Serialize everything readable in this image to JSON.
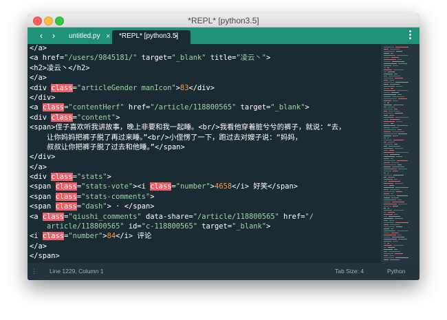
{
  "window": {
    "title": "*REPL* [python3.5]"
  },
  "nav": {
    "back_icon": "‹",
    "forward_icon": "›"
  },
  "tabs": [
    {
      "label": "untitled.py",
      "close": "×"
    },
    {
      "label": "*REPL* [python3.5]",
      "close": "×"
    }
  ],
  "colors": {
    "accent": "#1f9178",
    "editor_bg": "#1b2b34",
    "highlight": "#ec5f67",
    "string": "#9bd3a4",
    "number": "#f79a4b"
  },
  "code_lines": [
    [
      {
        "t": "t",
        "v": "</a>"
      }
    ],
    [
      {
        "t": "t",
        "v": "<a "
      },
      {
        "t": "a",
        "v": "href"
      },
      {
        "t": "t",
        "v": "="
      },
      {
        "t": "s",
        "v": "\"/users/9845181/\""
      },
      {
        "t": "t",
        "v": " "
      },
      {
        "t": "a",
        "v": "target"
      },
      {
        "t": "t",
        "v": "="
      },
      {
        "t": "s",
        "v": "\"_blank\""
      },
      {
        "t": "t",
        "v": " "
      },
      {
        "t": "a",
        "v": "title"
      },
      {
        "t": "t",
        "v": "="
      },
      {
        "t": "s",
        "v": "\"凌云丶\""
      },
      {
        "t": "t",
        "v": ">"
      }
    ],
    [
      {
        "t": "t",
        "v": "<h2>"
      },
      {
        "t": "x",
        "v": "凌云丶"
      },
      {
        "t": "t",
        "v": "</h2>"
      }
    ],
    [
      {
        "t": "t",
        "v": "</a>"
      }
    ],
    [
      {
        "t": "t",
        "v": "<div "
      },
      {
        "t": "k",
        "v": "class"
      },
      {
        "t": "t",
        "v": "="
      },
      {
        "t": "s",
        "v": "\"articleGender manIcon\""
      },
      {
        "t": "t",
        "v": ">"
      },
      {
        "t": "n",
        "v": "83"
      },
      {
        "t": "t",
        "v": "</div>"
      }
    ],
    [
      {
        "t": "t",
        "v": "</div>"
      }
    ],
    [
      {
        "t": "t",
        "v": "<a "
      },
      {
        "t": "k",
        "v": "class"
      },
      {
        "t": "t",
        "v": "="
      },
      {
        "t": "s",
        "v": "\"contentHerf\""
      },
      {
        "t": "t",
        "v": " "
      },
      {
        "t": "a",
        "v": "href"
      },
      {
        "t": "t",
        "v": "="
      },
      {
        "t": "s",
        "v": "\"/article/118800565\""
      },
      {
        "t": "t",
        "v": " "
      },
      {
        "t": "a",
        "v": "target"
      },
      {
        "t": "t",
        "v": "="
      },
      {
        "t": "s",
        "v": "\"_blank\""
      },
      {
        "t": "t",
        "v": ">"
      }
    ],
    [
      {
        "t": "t",
        "v": "<div "
      },
      {
        "t": "k",
        "v": "class"
      },
      {
        "t": "t",
        "v": "="
      },
      {
        "t": "s",
        "v": "\"content\""
      },
      {
        "t": "t",
        "v": ">"
      }
    ],
    [
      {
        "t": "t",
        "v": "<span>"
      },
      {
        "t": "x",
        "v": "侄子喜欢听我讲故事，晚上非要和我一起睡。"
      },
      {
        "t": "t",
        "v": "<br/>"
      },
      {
        "t": "x",
        "v": "我看他穿着脏兮兮的裤子，就说：“去，"
      }
    ],
    [
      {
        "t": "x",
        "v": "    让你妈妈把裤子脱了再过来睡。”"
      },
      {
        "t": "t",
        "v": "<br/>"
      },
      {
        "t": "x",
        "v": "小侄愣了一下，跑过去对嫂子说：“妈妈，"
      }
    ],
    [
      {
        "t": "x",
        "v": "    叔叔让你把裤子脱了过去和他睡。”"
      },
      {
        "t": "t",
        "v": "</span>"
      }
    ],
    [
      {
        "t": "t",
        "v": "</div>"
      }
    ],
    [
      {
        "t": "t",
        "v": "</a>"
      }
    ],
    [
      {
        "t": "t",
        "v": "<div "
      },
      {
        "t": "k",
        "v": "class"
      },
      {
        "t": "t",
        "v": "="
      },
      {
        "t": "s",
        "v": "\"stats\""
      },
      {
        "t": "t",
        "v": ">"
      }
    ],
    [
      {
        "t": "t",
        "v": "<span "
      },
      {
        "t": "k",
        "v": "class"
      },
      {
        "t": "t",
        "v": "="
      },
      {
        "t": "s",
        "v": "\"stats-vote\""
      },
      {
        "t": "t",
        "v": "><i "
      },
      {
        "t": "k",
        "v": "class"
      },
      {
        "t": "t",
        "v": "="
      },
      {
        "t": "s",
        "v": "\"number\""
      },
      {
        "t": "t",
        "v": ">"
      },
      {
        "t": "n",
        "v": "4658"
      },
      {
        "t": "t",
        "v": "</i>"
      },
      {
        "t": "x",
        "v": " 好笑"
      },
      {
        "t": "t",
        "v": "</span>"
      }
    ],
    [
      {
        "t": "t",
        "v": "<span "
      },
      {
        "t": "k",
        "v": "class"
      },
      {
        "t": "t",
        "v": "="
      },
      {
        "t": "s",
        "v": "\"stats-comments\""
      },
      {
        "t": "t",
        "v": ">"
      }
    ],
    [
      {
        "t": "t",
        "v": "<span "
      },
      {
        "t": "k",
        "v": "class"
      },
      {
        "t": "t",
        "v": "="
      },
      {
        "t": "s",
        "v": "\"dash\""
      },
      {
        "t": "t",
        "v": ">"
      },
      {
        "t": "x",
        "v": " · "
      },
      {
        "t": "t",
        "v": "</span>"
      }
    ],
    [
      {
        "t": "t",
        "v": "<a "
      },
      {
        "t": "k",
        "v": "class"
      },
      {
        "t": "t",
        "v": "="
      },
      {
        "t": "s",
        "v": "\"qiushi_comments\""
      },
      {
        "t": "t",
        "v": " "
      },
      {
        "t": "a",
        "v": "data-share"
      },
      {
        "t": "t",
        "v": "="
      },
      {
        "t": "s",
        "v": "\"/article/118800565\""
      },
      {
        "t": "t",
        "v": " "
      },
      {
        "t": "a",
        "v": "href"
      },
      {
        "t": "t",
        "v": "="
      },
      {
        "t": "s",
        "v": "\"/"
      }
    ],
    [
      {
        "t": "s",
        "v": "    article/118800565\""
      },
      {
        "t": "t",
        "v": " "
      },
      {
        "t": "a",
        "v": "id"
      },
      {
        "t": "t",
        "v": "="
      },
      {
        "t": "s",
        "v": "\"c-118800565\""
      },
      {
        "t": "t",
        "v": " "
      },
      {
        "t": "a",
        "v": "target"
      },
      {
        "t": "t",
        "v": "="
      },
      {
        "t": "s",
        "v": "\"_blank\""
      },
      {
        "t": "t",
        "v": ">"
      }
    ],
    [
      {
        "t": "t",
        "v": "<i "
      },
      {
        "t": "k",
        "v": "class"
      },
      {
        "t": "t",
        "v": "="
      },
      {
        "t": "s",
        "v": "\"number\""
      },
      {
        "t": "t",
        "v": ">"
      },
      {
        "t": "n",
        "v": "84"
      },
      {
        "t": "t",
        "v": "</i>"
      },
      {
        "t": "x",
        "v": " 评论"
      }
    ],
    [
      {
        "t": "t",
        "v": "</a>"
      }
    ],
    [
      {
        "t": "t",
        "v": "</span>"
      }
    ],
    [
      {
        "t": "t",
        "v": "</div>"
      }
    ]
  ],
  "status": {
    "position": "Line 1229, Column 1",
    "tab_size": "Tab Size: 4",
    "syntax": "Python"
  }
}
